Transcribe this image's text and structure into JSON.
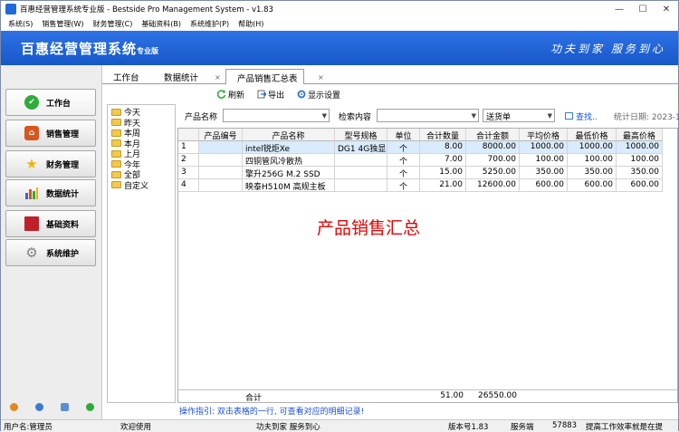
{
  "window": {
    "title": "百惠经营管理系统专业版 - Bestside Pro Management System - v1.83",
    "minimize": "—",
    "maximize": "☐",
    "close": "✕"
  },
  "menu": [
    "系统(S)",
    "销售管理(W)",
    "财务管理(C)",
    "基础资料(B)",
    "系统维护(P)",
    "帮助(H)"
  ],
  "banner": {
    "title": "百惠经营管理系统",
    "edition": "专业版",
    "slogan": "功夫到家 服务到心"
  },
  "nav": [
    {
      "label": "工作台",
      "icon": "checkmark-icon",
      "color": "#2eab3a"
    },
    {
      "label": "销售管理",
      "icon": "house-icon",
      "color": "#d9541e"
    },
    {
      "label": "财务管理",
      "icon": "star-icon",
      "color": "#f0b400"
    },
    {
      "label": "数据统计",
      "icon": "bar-chart-icon",
      "color": "#3c64c8"
    },
    {
      "label": "基础资料",
      "icon": "book-icon",
      "color": "#c0202a"
    },
    {
      "label": "系统维护",
      "icon": "gear-icon",
      "color": "#808080"
    }
  ],
  "tabs": [
    {
      "label": "工作台"
    },
    {
      "label": "数据统计",
      "close": "×"
    },
    {
      "label": "产品销售汇总表",
      "close": "×"
    }
  ],
  "toolbar": {
    "refresh": "刷新",
    "export": "导出",
    "display_settings": "显示设置"
  },
  "date_tree": [
    "今天",
    "昨天",
    "本周",
    "本月",
    "上月",
    "今年",
    "全部",
    "自定义"
  ],
  "search": {
    "product_name_label": "产品名称",
    "search_content_label": "检索内容",
    "doc_type": "送货单",
    "find_link": "查找..",
    "stat_date": "统计日期: 2023-1"
  },
  "table": {
    "headers": [
      "",
      "产品编号",
      "产品名称",
      "型号规格",
      "单位",
      "合计数量",
      "合计金额",
      "平均价格",
      "最低价格",
      "最高价格"
    ],
    "rows": [
      [
        "1",
        "",
        "intel锐炬Xe",
        "DG1 4G独显",
        "个",
        "8.00",
        "8000.00",
        "1000.00",
        "1000.00",
        "1000.00"
      ],
      [
        "2",
        "",
        "四铜管风冷散热",
        "",
        "个",
        "7.00",
        "700.00",
        "100.00",
        "100.00",
        "100.00"
      ],
      [
        "3",
        "",
        "擎升256G M.2 SSD",
        "",
        "个",
        "15.00",
        "5250.00",
        "350.00",
        "350.00",
        "350.00"
      ],
      [
        "4",
        "",
        "映泰H510M 高规主板",
        "",
        "个",
        "21.00",
        "12600.00",
        "600.00",
        "600.00",
        "600.00"
      ]
    ],
    "footer": {
      "label": "合计",
      "qty": "51.00",
      "amount": "26550.00"
    }
  },
  "watermark": "产品销售汇总",
  "hint": "操作指引: 双击表格的一行, 可查看对应的明细记录!",
  "status": {
    "user": "用户名:管理员",
    "welcome": "欢迎使用",
    "slogan": "功夫到家 服务到心",
    "version": "版本号1.83",
    "service": "服务端",
    "code": "57883",
    "tip": "提高工作效率就是在提"
  }
}
